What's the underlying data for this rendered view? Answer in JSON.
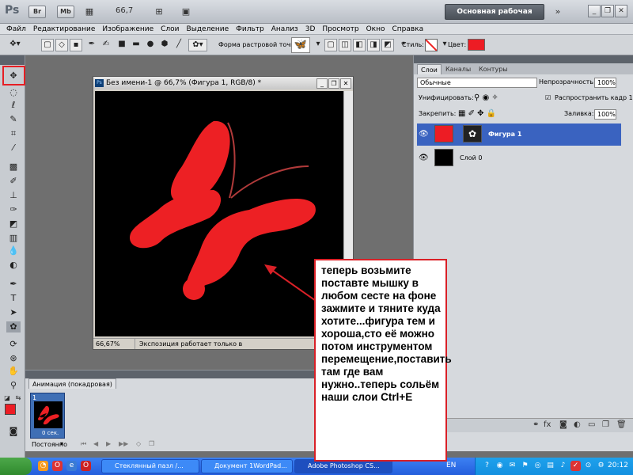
{
  "appbar": {
    "logo": "Ps",
    "btn_br": "Br",
    "btn_mb": "Mb",
    "zoom": "66,7",
    "workspace": "Основная рабочая среда"
  },
  "menu": [
    "Файл",
    "Редактирование",
    "Изображение",
    "Слои",
    "Выделение",
    "Фильтр",
    "Анализ",
    "3D",
    "Просмотр",
    "Окно",
    "Справка"
  ],
  "options": {
    "shape_label": "Форма растровой точки:",
    "style_label": "Стиль:",
    "color_label": "Цвет:",
    "color": "#ed1c24"
  },
  "document": {
    "title": "Без имени-1 @ 66,7% (Фигура 1, RGB/8) *",
    "zoom": "66,67%",
    "info": "Экспозиция работает только в ..."
  },
  "callout": {
    "text": "теперь возьмите поставте мышку в любом сесте на фоне зажмите и тяните куда хотите...фигура тем и хороша,сто её можно потом инструментом перемещение,поставить там где вам нужно..теперь сольём наши слои Ctrl+E"
  },
  "layers_panel": {
    "tabs": [
      "Слои",
      "Каналы",
      "Контуры"
    ],
    "blend_mode": "Обычные",
    "opacity_label": "Непрозрачность:",
    "opacity": "100%",
    "unify_label": "Унифицировать:",
    "propagate_label": "Распространить кадр 1",
    "lock_label": "Закрепить:",
    "fill_label": "Заливка:",
    "fill": "100%",
    "layers": [
      {
        "name": "Фигура 1",
        "selected": true
      },
      {
        "name": "Слой 0",
        "selected": false
      }
    ]
  },
  "animation": {
    "tab": "Анимация (покадровая)",
    "frame_number": "1",
    "frame_time": "0 сек.",
    "loop": "Постоянно"
  },
  "taskbar": {
    "tasks": [
      "Стеклянный пазл /...",
      "Документ 1WordPad...",
      "Adobe Photoshop CS..."
    ],
    "language": "EN",
    "clock": "20:12"
  },
  "colors": {
    "accent_red": "#ed1c24",
    "selection_blue": "#3f6fb5"
  }
}
